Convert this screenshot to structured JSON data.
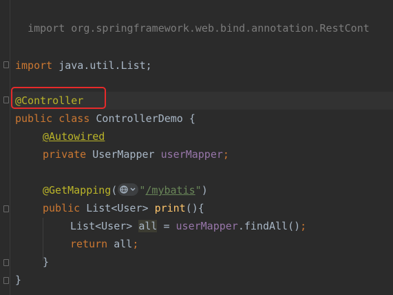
{
  "editor": {
    "lines": {
      "l1": "import org.springframework.web.bind.annotation.RestCont",
      "l2_kw": "import",
      "l2_rest": " java.util.List;",
      "l3_ann": "@Controller",
      "l4_kw": "public class",
      "l4_rest": " ControllerDemo {",
      "l5_ann": "@Autowired",
      "l6_kw": "private",
      "l6_type": " UserMapper ",
      "l6_field": "userMapper",
      "l6_end": ";",
      "l7_ann": "@GetMapping",
      "l7_open": "(",
      "l7_q1": "\"",
      "l7_path": "/mybatis",
      "l7_q2": "\"",
      "l7_close": ")",
      "l8_kw": "public",
      "l8_type": " List<User> ",
      "l8_method": "print",
      "l8_end": "(){",
      "l9_type": "List<User> ",
      "l9_var": "all",
      "l9_eq": " = ",
      "l9_field": "userMapper",
      "l9_call": ".findAll()",
      "l9_end": ";",
      "l10_kw": "return",
      "l10_rest": " all",
      "l10_end": ";",
      "l11": "}",
      "l12": "}"
    },
    "colors": {
      "background": "#2b2b2b",
      "keyword": "#cc7832",
      "annotation": "#bbb529",
      "field": "#9876aa",
      "method": "#ffc66d",
      "string": "#6a8759",
      "highlight_box": "#e82a2a"
    },
    "icons": {
      "mapping_gutter_icon": "globe-icon",
      "chevron": "chevron-down-icon"
    }
  }
}
